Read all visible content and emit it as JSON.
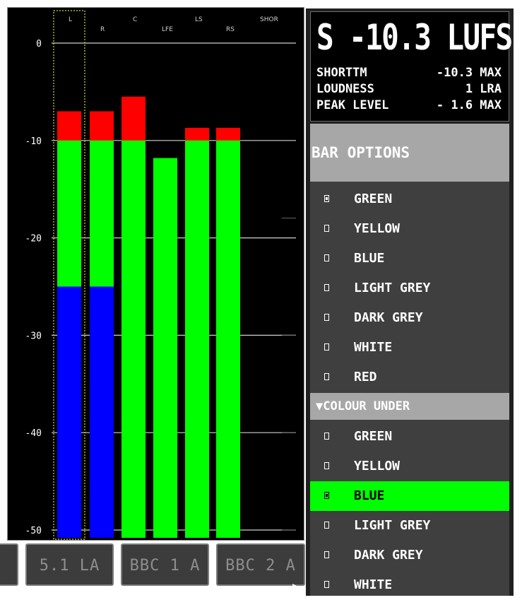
{
  "meter": {
    "channel_labels": [
      "L",
      "R",
      "C",
      "LFE",
      "LS",
      "RS",
      "SHOR"
    ],
    "scale_labels": [
      "0",
      "-10",
      "-20",
      "-30",
      "-40",
      "-50"
    ],
    "scale_values": [
      0,
      -10,
      -20,
      -30,
      -40,
      -50
    ],
    "bars": [
      {
        "channel": "L",
        "peak_top_db": -7,
        "green_top_db": -10,
        "blue_top_db": -25
      },
      {
        "channel": "R",
        "peak_top_db": -7,
        "green_top_db": -10,
        "blue_top_db": -25
      },
      {
        "channel": "C",
        "peak_top_db": -5.5,
        "green_top_db": -10,
        "blue_top_db": null
      },
      {
        "channel": "LFE",
        "peak_top_db": null,
        "green_top_db": -11.8,
        "blue_top_db": null
      },
      {
        "channel": "LS",
        "peak_top_db": -8.7,
        "green_top_db": -10,
        "blue_top_db": null
      },
      {
        "channel": "RS",
        "peak_top_db": -8.7,
        "green_top_db": -10,
        "blue_top_db": null
      }
    ],
    "colors": {
      "peak": "#ff0000",
      "green": "#00ff00",
      "blue": "#0000ff",
      "selected_outline": "#d7d72a"
    }
  },
  "presets": [
    "5.1 LA",
    "BBC 1 A",
    "BBC 2 A"
  ],
  "readout": {
    "main": "S -10.3 LUFS",
    "rows": [
      {
        "left": "SHORTTM",
        "right": "-10.3 MAX"
      },
      {
        "left": "LOUDNESS",
        "right": "1 LRA"
      },
      {
        "left": "PEAK LEVEL",
        "right": "- 1.6 MAX"
      }
    ]
  },
  "bar_options": {
    "title": "BAR OPTIONS",
    "items": [
      {
        "label": "GREEN",
        "checked": true
      },
      {
        "label": "YELLOW",
        "checked": false
      },
      {
        "label": "BLUE",
        "checked": false
      },
      {
        "label": "LIGHT GREY",
        "checked": false
      },
      {
        "label": "DARK GREY",
        "checked": false
      },
      {
        "label": "WHITE",
        "checked": false
      },
      {
        "label": "RED",
        "checked": false
      }
    ]
  },
  "colour_under": {
    "title": "▼COLOUR UNDER",
    "items": [
      {
        "label": "GREEN",
        "checked": false
      },
      {
        "label": "YELLOW",
        "checked": false
      },
      {
        "label": "BLUE",
        "checked": true,
        "selected": true
      },
      {
        "label": "LIGHT GREY",
        "checked": false
      },
      {
        "label": "DARK GREY",
        "checked": false
      },
      {
        "label": "WHITE",
        "checked": false
      }
    ]
  }
}
